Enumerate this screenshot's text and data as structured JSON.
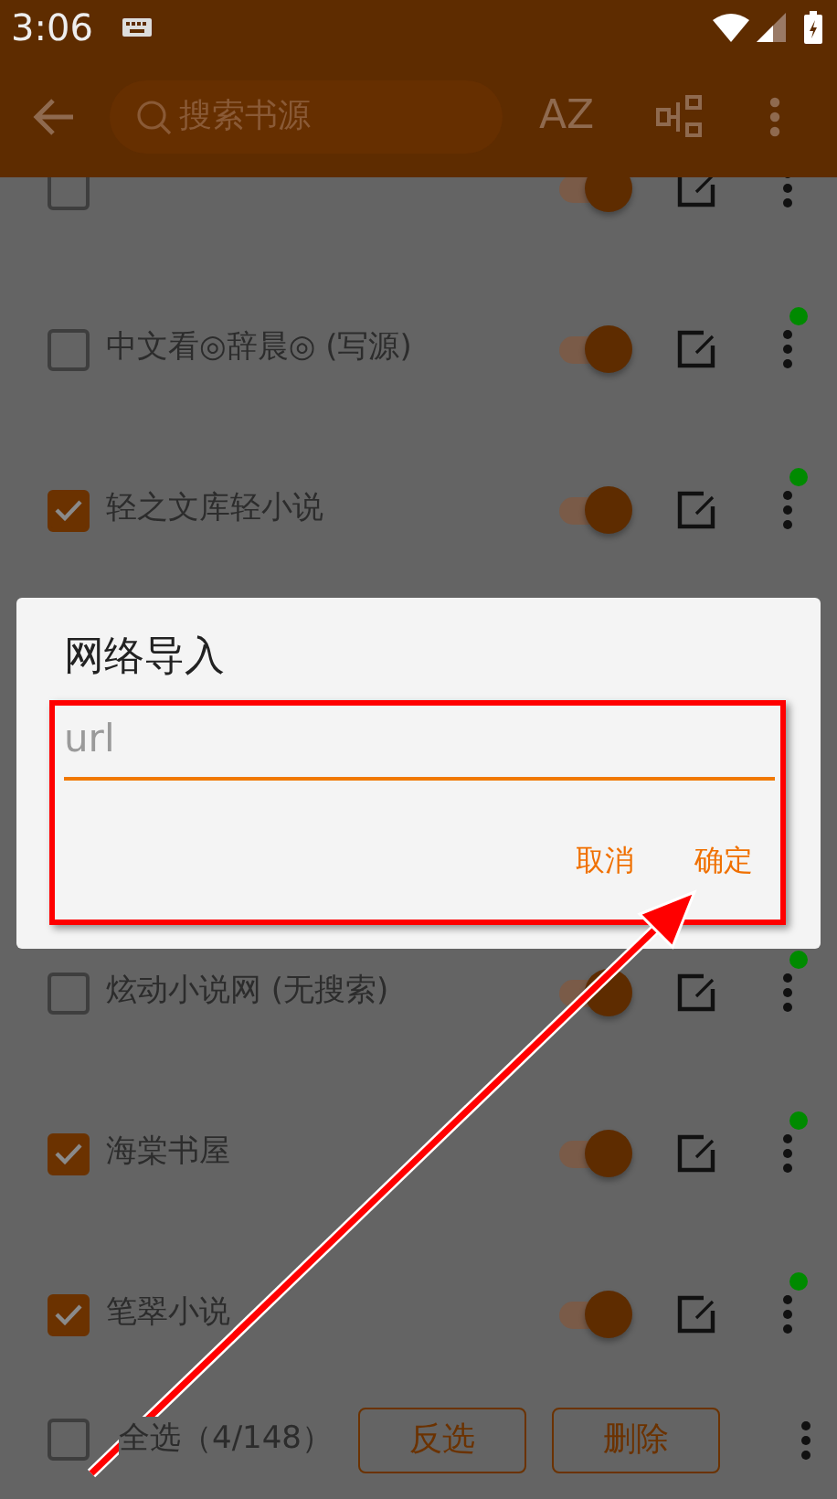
{
  "status_bar": {
    "time": "3:06"
  },
  "toolbar": {
    "search": {
      "placeholder": "搜索书源"
    },
    "sort_label": "AZ"
  },
  "sources_above": [
    {
      "kind": "clipped",
      "checked": false,
      "on": true
    },
    {
      "kind": "row",
      "name": "中文看◎辞晨◎ (写源)",
      "checked": false,
      "on": true,
      "online": true
    },
    {
      "kind": "row",
      "name": "轻之文库轻小说",
      "checked": true,
      "on": true,
      "online": true
    }
  ],
  "sources_below": [
    {
      "kind": "row",
      "name": "炫动小说网 (无搜索)",
      "checked": false,
      "on": true,
      "online": true
    },
    {
      "kind": "row",
      "name": "海棠书屋",
      "checked": true,
      "on": true,
      "online": true
    },
    {
      "kind": "row",
      "name": "笔翠小说",
      "checked": true,
      "on": true,
      "online": true
    }
  ],
  "bottom_bar": {
    "select_all": {
      "label": "全选（4/148）",
      "checked": false
    },
    "buttons": [
      "反选",
      "删除"
    ]
  },
  "dialog": {
    "title": "网络导入",
    "field": {
      "placeholder": "url"
    },
    "buttons": [
      "取消",
      "确定"
    ]
  }
}
